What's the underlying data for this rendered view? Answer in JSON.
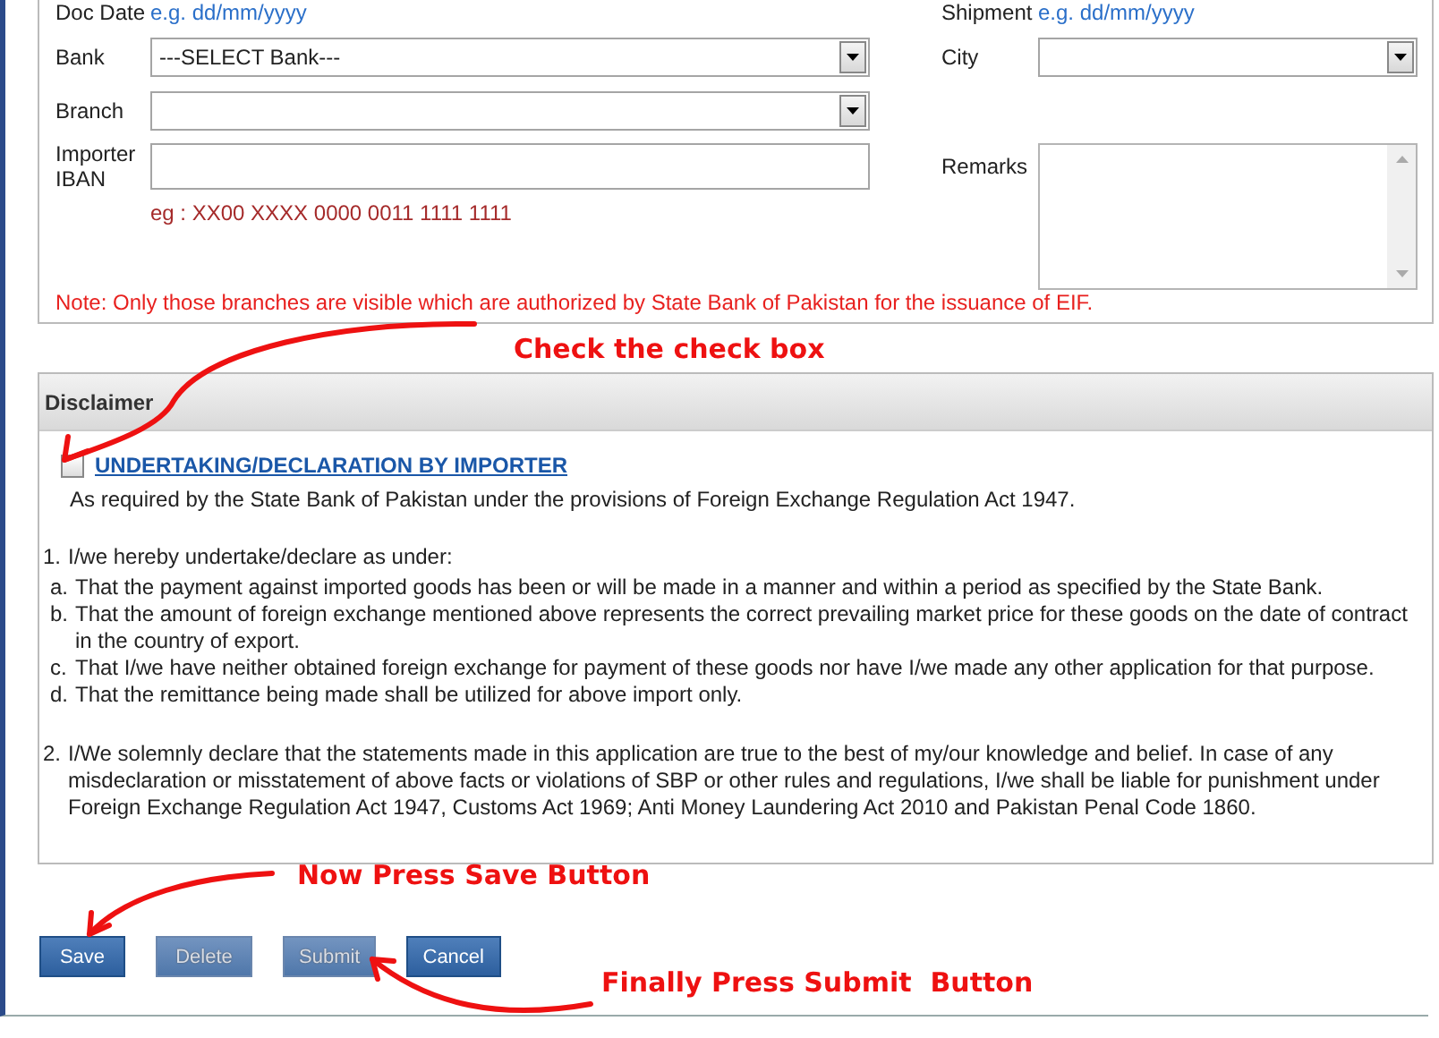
{
  "form": {
    "left_fields": [
      {
        "kind": "date",
        "label": "Doc Date",
        "hint": "e.g. dd/mm/yyyy"
      },
      {
        "kind": "select",
        "label": "Bank",
        "value": "---SELECT Bank---"
      },
      {
        "kind": "select",
        "label": "Branch"
      },
      {
        "kind": "text",
        "label": "Importer IBAN",
        "hint": "eg : XX00 XXXX 0000 0011 1111 1111"
      }
    ],
    "right_fields": [
      {
        "kind": "date",
        "label": "Shipment",
        "hint": "e.g. dd/mm/yyyy"
      },
      {
        "kind": "select",
        "label": "City"
      },
      {
        "kind": "textarea",
        "label": "Remarks"
      }
    ],
    "note": "Note: Only those branches are visible which are authorized by State Bank of Pakistan for the issuance of EIF."
  },
  "disclaimer": {
    "title": "Disclaimer",
    "checkbox": {
      "label": "UNDERTAKING/DECLARATION BY IMPORTER",
      "checked": false
    },
    "intro": "As required by the State Bank of Pakistan under the provisions of Foreign Exchange Regulation Act 1947.",
    "items": [
      {
        "marker": "1.",
        "text": "I/we hereby undertake/declare as under:",
        "children": [
          {
            "marker": "a.",
            "text": "That the payment against imported goods has been or will be made in a manner and within a period as specified by the State Bank."
          },
          {
            "marker": "b.",
            "text": "That the amount of foreign exchange mentioned above represents the correct prevailing market price for these goods on the date of contract in the country of export."
          },
          {
            "marker": "c.",
            "text": "That I/we have neither obtained foreign exchange for payment of these goods nor have I/we made any other application for that purpose."
          },
          {
            "marker": "d.",
            "text": "That the remittance being made shall be utilized for above import only."
          }
        ]
      },
      {
        "marker": "2.",
        "text": "I/We solemnly declare that the statements made in this application are true to the best of my/our knowledge and belief. In case of any misdeclaration or misstatement of above facts or violations of SBP or other rules and regulations, I/we shall be liable for punishment under Foreign Exchange Regulation Act 1947, Customs Act 1969; Anti Money Laundering Act 2010 and Pakistan Penal Code 1860."
      }
    ]
  },
  "buttons": [
    {
      "label": "Save",
      "disabled": false
    },
    {
      "label": "Delete",
      "disabled": true
    },
    {
      "label": "Submit",
      "disabled": true
    },
    {
      "label": "Cancel",
      "disabled": false
    }
  ],
  "annotations": [
    {
      "text": "Check the check box"
    },
    {
      "text": "Now Press Save Button"
    },
    {
      "text": "Finally Press Submit  Button"
    }
  ]
}
